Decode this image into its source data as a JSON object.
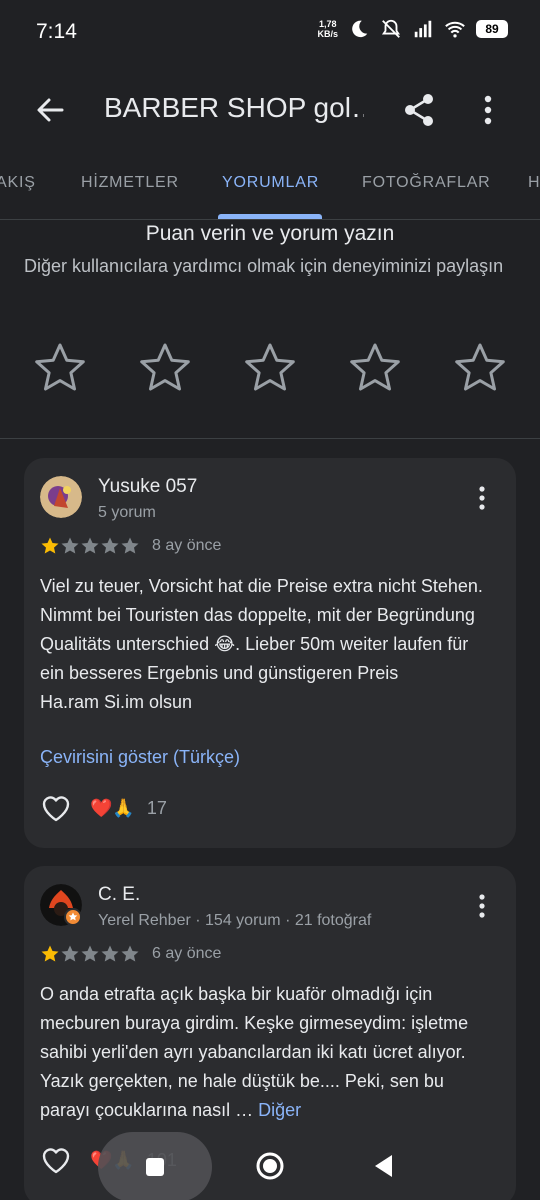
{
  "status_bar": {
    "time": "7:14",
    "net_speed_value": "1,78",
    "net_speed_unit": "KB/s",
    "battery": "89",
    "icons": [
      "moon-icon",
      "bell-off-icon",
      "signal-icon",
      "wifi-icon"
    ]
  },
  "app_bar": {
    "title": "BARBER SHOP gol…",
    "back_icon": "arrow-back-icon",
    "share_icon": "share-icon",
    "more_icon": "more-vert-icon"
  },
  "tabs": [
    {
      "label": "AKIŞ",
      "active": false
    },
    {
      "label": "HİZMETLER",
      "active": false
    },
    {
      "label": "YORUMLAR",
      "active": true
    },
    {
      "label": "FOTOĞRAFLAR",
      "active": false
    },
    {
      "label": "H",
      "active": false
    }
  ],
  "rate_section": {
    "title": "Puan verin ve yorum yazın",
    "subtitle": "Diğer kullanıcılara yardımcı olmak için deneyiminizi paylaşın",
    "star_count": 5
  },
  "reviews": [
    {
      "author": "Yusuke 057",
      "meta": "5 yorum",
      "rating": 1,
      "max_rating": 5,
      "time_ago": "8 ay önce",
      "text": "Viel zu teuer, Vorsicht hat die Preise extra nicht Stehen. Nimmt bei Touristen das doppelte, mit der Begründung Qualitäts unterschied 😂. Lieber 50m weiter laufen für ein besseres Ergebnis und günstigeren Preis\nHa.ram Si.im olsun",
      "translate_link": "Çevirisini göster (Türkçe)",
      "reaction_emojis": "❤️🙏",
      "reaction_count": "17"
    },
    {
      "author": "C. E.",
      "meta": "Yerel Rehber · 154 yorum · 21 fotoğraf",
      "rating": 1,
      "max_rating": 5,
      "time_ago": "6 ay önce",
      "text": "O anda etrafta açık başka bir kuaför olmadığı için mecburen buraya girdim. Keşke girmeseydim: işletme sahibi yerli'den ayrı yabancılardan iki katı ücret alıyor. Yazık gerçekten, ne hale düştük be.... Peki, sen bu parayı çocuklarına nasıl …",
      "more_link": "Diğer",
      "reaction_emojis": "❤️🙏",
      "reaction_count": "101"
    }
  ],
  "colors": {
    "background": "#202124",
    "card": "#2b2c2f",
    "accent": "#8ab4f8",
    "star_filled": "#fbbc04",
    "star_empty": "#9aa0a6"
  }
}
